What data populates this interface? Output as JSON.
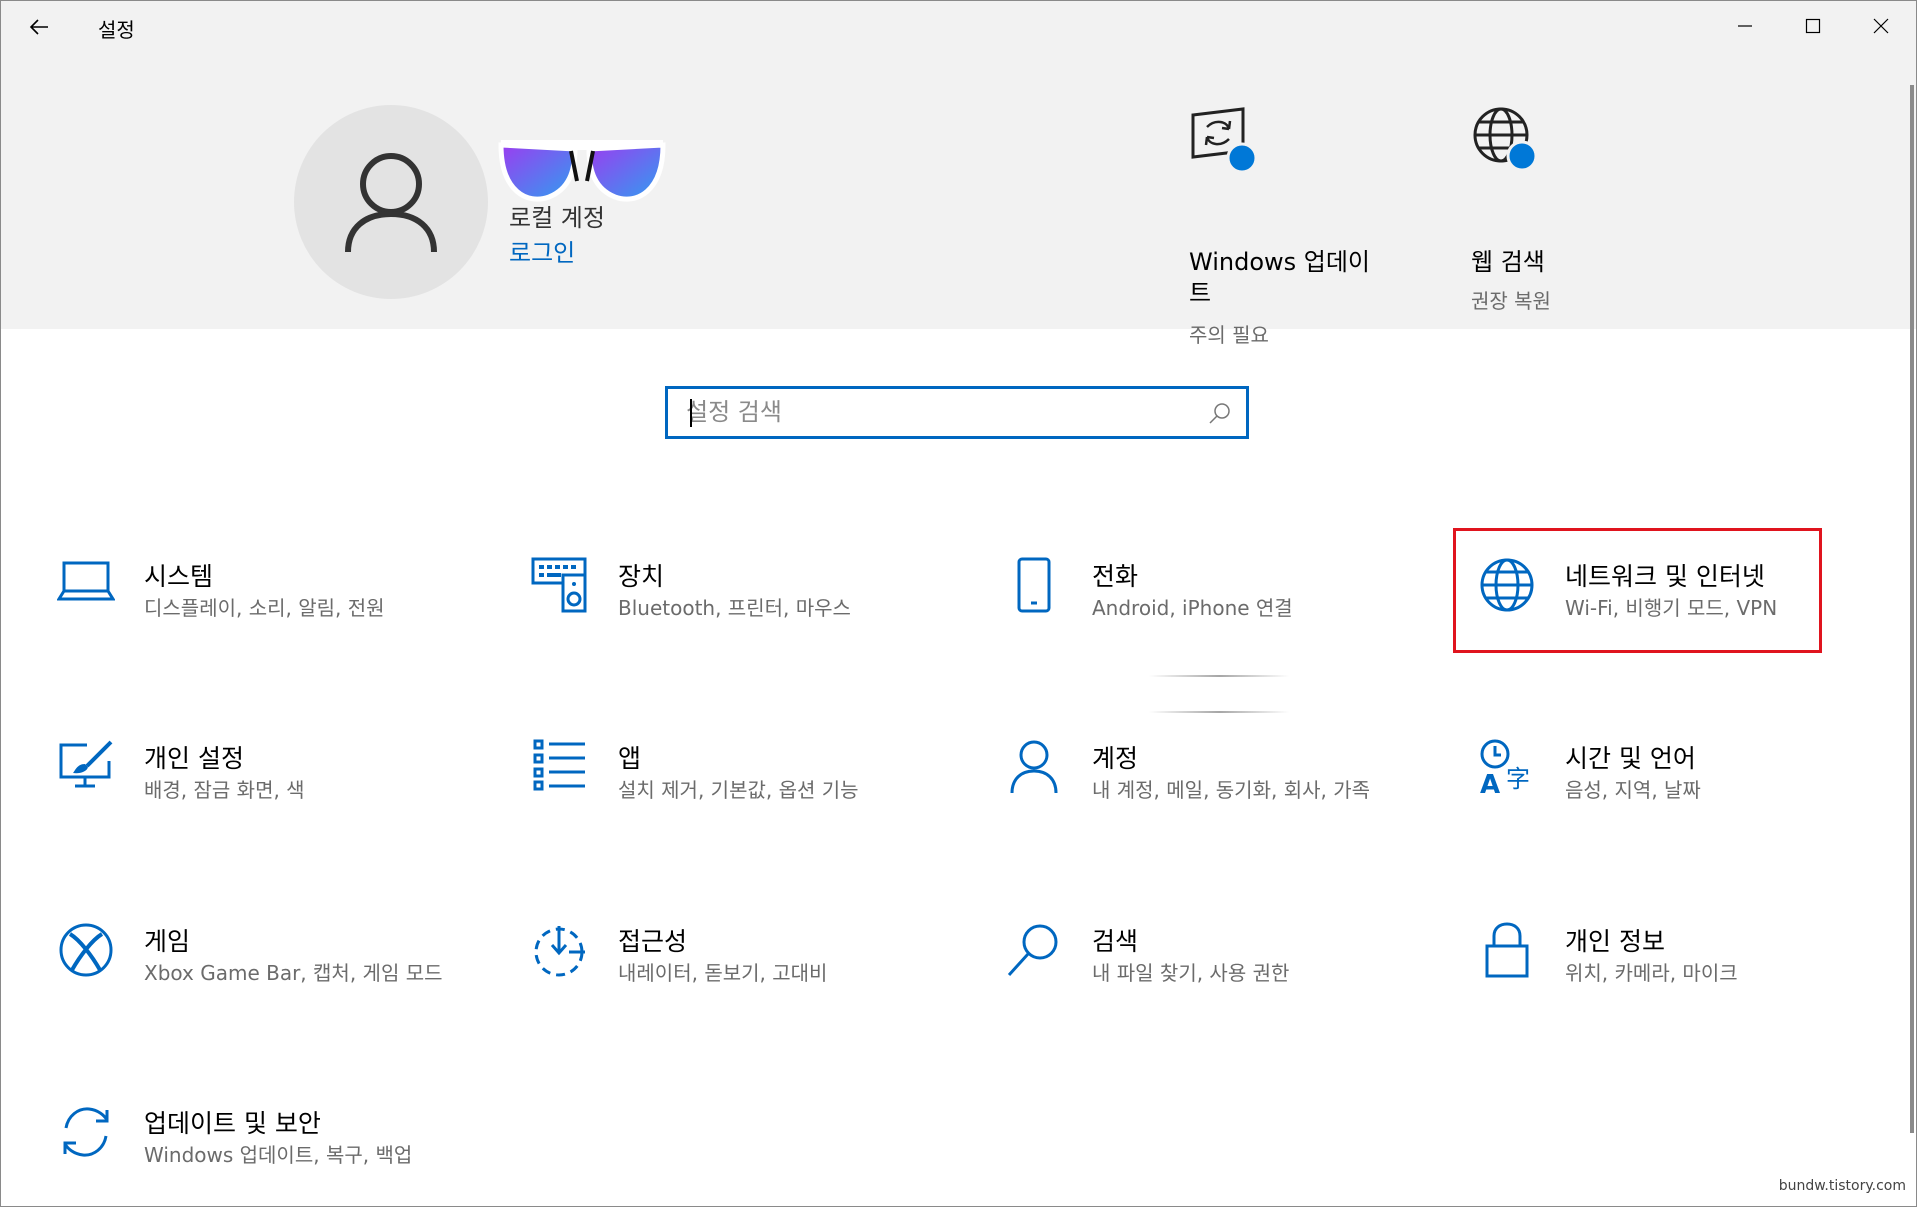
{
  "window": {
    "title": "설정"
  },
  "account": {
    "name": "로컬 계정",
    "sign_in": "로그인"
  },
  "quick_links": [
    {
      "title": "Windows 업데이트",
      "subtitle": "주의 필요"
    },
    {
      "title": "웹 검색",
      "subtitle": "권장 복원"
    }
  ],
  "search": {
    "placeholder": "설정 검색"
  },
  "categories": [
    {
      "title": "시스템",
      "desc": "디스플레이, 소리, 알림, 전원"
    },
    {
      "title": "장치",
      "desc": "Bluetooth, 프린터, 마우스"
    },
    {
      "title": "전화",
      "desc": "Android, iPhone 연결"
    },
    {
      "title": "네트워크 및 인터넷",
      "desc": "Wi-Fi, 비행기 모드, VPN"
    },
    {
      "title": "개인 설정",
      "desc": "배경, 잠금 화면, 색"
    },
    {
      "title": "앱",
      "desc": "설치 제거, 기본값, 옵션 기능"
    },
    {
      "title": "계정",
      "desc": "내 계정, 메일, 동기화, 회사, 가족"
    },
    {
      "title": "시간 및 언어",
      "desc": "음성, 지역, 날짜"
    },
    {
      "title": "게임",
      "desc": "Xbox Game Bar, 캡처, 게임 모드"
    },
    {
      "title": "접근성",
      "desc": "내레이터, 돋보기, 고대비"
    },
    {
      "title": "검색",
      "desc": "내 파일 찾기, 사용 권한"
    },
    {
      "title": "개인 정보",
      "desc": "위치, 카메라, 마이크"
    },
    {
      "title": "업데이트 및 보안",
      "desc": "Windows 업데이트, 복구, 백업"
    }
  ],
  "watermark": "bundw.tistory.com",
  "colors": {
    "accent": "#0067c0",
    "highlight": "#e0141e",
    "header_bg": "#f2f2f2"
  }
}
